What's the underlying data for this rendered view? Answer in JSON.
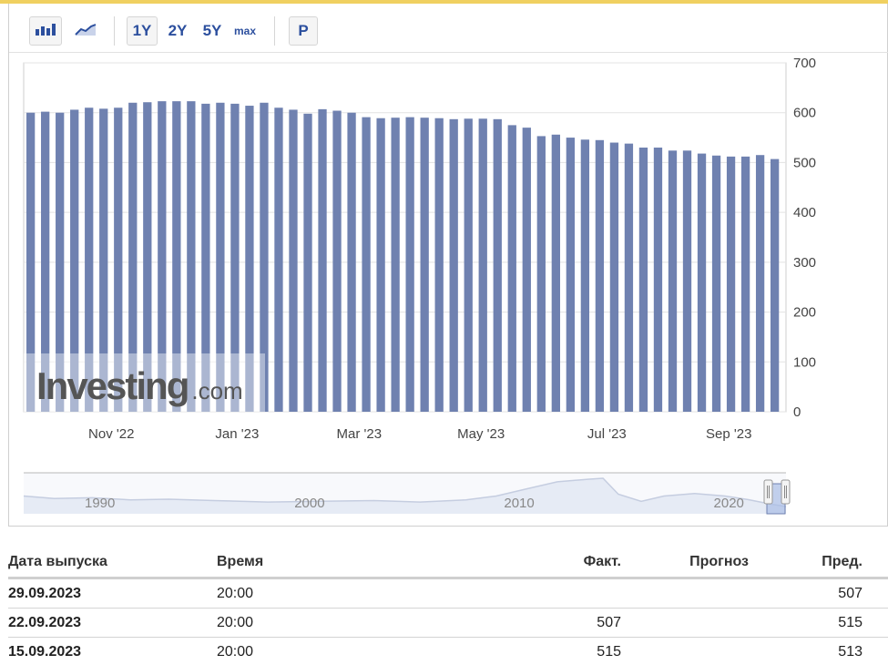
{
  "toolbar": {
    "buttons": {
      "bar_chart": "bar-chart-icon",
      "line_chart": "line-chart-icon",
      "y1": "1Y",
      "y2": "2Y",
      "y5": "5Y",
      "max": "max",
      "p": "P"
    }
  },
  "colors": {
    "bar": "#6f81b0",
    "accent": "#2c4f9e",
    "top_border": "#f0d060"
  },
  "chart_data": {
    "type": "bar",
    "x_tick_labels": [
      "Nov '22",
      "Jan '23",
      "Mar '23",
      "May '23",
      "Jul '23",
      "Sep '23"
    ],
    "y_ticks": [
      0,
      100,
      200,
      300,
      400,
      500,
      600,
      700
    ],
    "ylim": [
      0,
      700
    ],
    "y_axis_side": "right",
    "grid": true,
    "values": [
      600,
      602,
      600,
      606,
      610,
      608,
      610,
      620,
      621,
      623,
      623,
      623,
      618,
      620,
      618,
      614,
      620,
      610,
      606,
      598,
      607,
      604,
      600,
      591,
      589,
      590,
      591,
      590,
      589,
      587,
      588,
      588,
      587,
      575,
      570,
      553,
      556,
      550,
      546,
      545,
      540,
      538,
      530,
      530,
      524,
      524,
      518,
      514,
      512,
      512,
      515,
      507
    ],
    "watermark": "Investing.com",
    "navigator": {
      "labels": [
        "1990",
        "2000",
        "2010",
        "2020"
      ]
    }
  },
  "table": {
    "headers": {
      "date": "Дата выпуска",
      "time": "Время",
      "actual": "Факт.",
      "forecast": "Прогноз",
      "previous": "Пред."
    },
    "rows": [
      {
        "date": "29.09.2023",
        "time": "20:00",
        "actual": "",
        "forecast": "",
        "previous": "507"
      },
      {
        "date": "22.09.2023",
        "time": "20:00",
        "actual": "507",
        "forecast": "",
        "previous": "515"
      },
      {
        "date": "15.09.2023",
        "time": "20:00",
        "actual": "515",
        "forecast": "",
        "previous": "513"
      }
    ]
  }
}
